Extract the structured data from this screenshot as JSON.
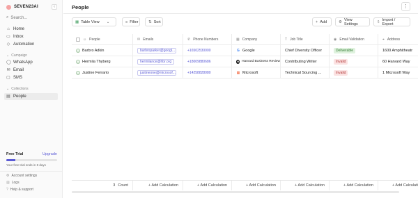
{
  "sidebar": {
    "brand": "SEVEN23AI",
    "collapse_icon": "‹",
    "search_placeholder": "Search...",
    "nav": [
      {
        "label": "Home",
        "icon": "home-icon"
      },
      {
        "label": "Inbox",
        "icon": "inbox-icon"
      },
      {
        "label": "Automation",
        "icon": "automation-icon"
      }
    ],
    "campaign_title": "Campaign",
    "campaign_items": [
      {
        "label": "WhatsApp",
        "icon": "whatsapp-icon"
      },
      {
        "label": "Email",
        "icon": "email-icon"
      },
      {
        "label": "SMS",
        "icon": "sms-icon"
      }
    ],
    "collections_title": "Collections",
    "collection_items": [
      {
        "label": "People",
        "icon": "people-icon"
      }
    ],
    "trial": {
      "title": "Free Trial",
      "upgrade": "Upgrade",
      "progress_fraction": 0.18,
      "note": "Your free trial ends in 8 days"
    },
    "footer": [
      {
        "label": "Account settings",
        "icon": "settings-icon"
      },
      {
        "label": "Logs",
        "icon": "logs-icon"
      },
      {
        "label": "Help & support",
        "icon": "help-icon"
      }
    ]
  },
  "header": {
    "title": "People",
    "more_icon": "⋮"
  },
  "toolbar": {
    "view_label": "Table View",
    "filter_label": "Filter",
    "sort_label": "Sort",
    "add_label": "Add",
    "view_settings_label": "View Settings",
    "import_export_label": "Import / Export"
  },
  "table": {
    "columns": [
      "People",
      "Emails",
      "Phone Numbers",
      "Company",
      "Job Title",
      "Email Validation",
      "Address"
    ],
    "rows": [
      {
        "name": "Barbro Adkin",
        "email": "barbroparker@googl...",
        "phone": "+16502530000",
        "company": "Google",
        "company_logo": "G",
        "company_color": "#4285f4",
        "job": "Chief Diversity Officer",
        "validation": "Deliverable",
        "validation_status": "ok",
        "address": "1600 Amphitheatr"
      },
      {
        "name": "Hermila Thyberg",
        "email": "hermilance@hbr.org",
        "phone": "+18009880686",
        "company": "Harvard Business Review",
        "company_logo": "H",
        "company_color": "#111111",
        "job": "Contributing Writer",
        "validation": "Invalid",
        "validation_status": "bad",
        "address": "60 Harvard Way"
      },
      {
        "name": "Justine Ferrario",
        "email": "justineone@microsof...",
        "phone": "+14258828080",
        "company": "Microsoft",
        "company_logo": "▦",
        "company_color": "#f25022",
        "job": "Technical Sourcing ...",
        "validation": "Invalid",
        "validation_status": "bad",
        "address": "1 Microsoft Way"
      }
    ],
    "footer": {
      "count_value": "3",
      "count_label": "Count",
      "add_calc": "+ Add Calculation"
    }
  }
}
